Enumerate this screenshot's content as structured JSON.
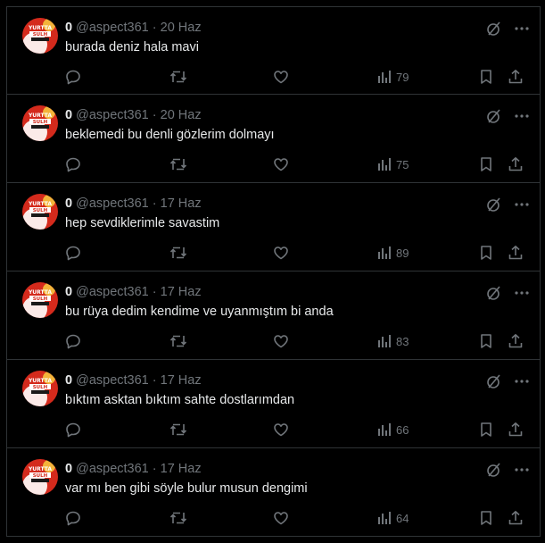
{
  "colors": {
    "background": "#000000",
    "border": "#2f3336",
    "text_primary": "#e7e9ea",
    "text_secondary": "#71767b"
  },
  "icons": {
    "reply": "reply-icon",
    "repost": "repost-icon",
    "like": "like-icon",
    "views": "views-icon",
    "bookmark": "bookmark-icon",
    "share": "share-icon",
    "grok": "grok-icon",
    "more": "more-icon"
  },
  "tweets": [
    {
      "name": "0",
      "handle": "@aspect361",
      "date": "· 20 Haz",
      "text": "burada deniz hala mavi",
      "views": "79"
    },
    {
      "name": "0",
      "handle": "@aspect361",
      "date": "· 20 Haz",
      "text": "beklemedi bu denli gözlerim dolmayı",
      "views": "75"
    },
    {
      "name": "0",
      "handle": "@aspect361",
      "date": "· 17 Haz",
      "text": "hep sevdiklerimle savastim",
      "views": "89"
    },
    {
      "name": "0",
      "handle": "@aspect361",
      "date": "· 17 Haz",
      "text": "bu rüya dedim kendime ve uyanmıştım bi anda",
      "views": "83"
    },
    {
      "name": "0",
      "handle": "@aspect361",
      "date": "· 17 Haz",
      "text": "bıktım asktan bıktım sahte dostlarımdan",
      "views": "66"
    },
    {
      "name": "0",
      "handle": "@aspect361",
      "date": "· 17 Haz",
      "text": "var mı ben gibi söyle bulur musun dengimi",
      "views": "64"
    }
  ]
}
